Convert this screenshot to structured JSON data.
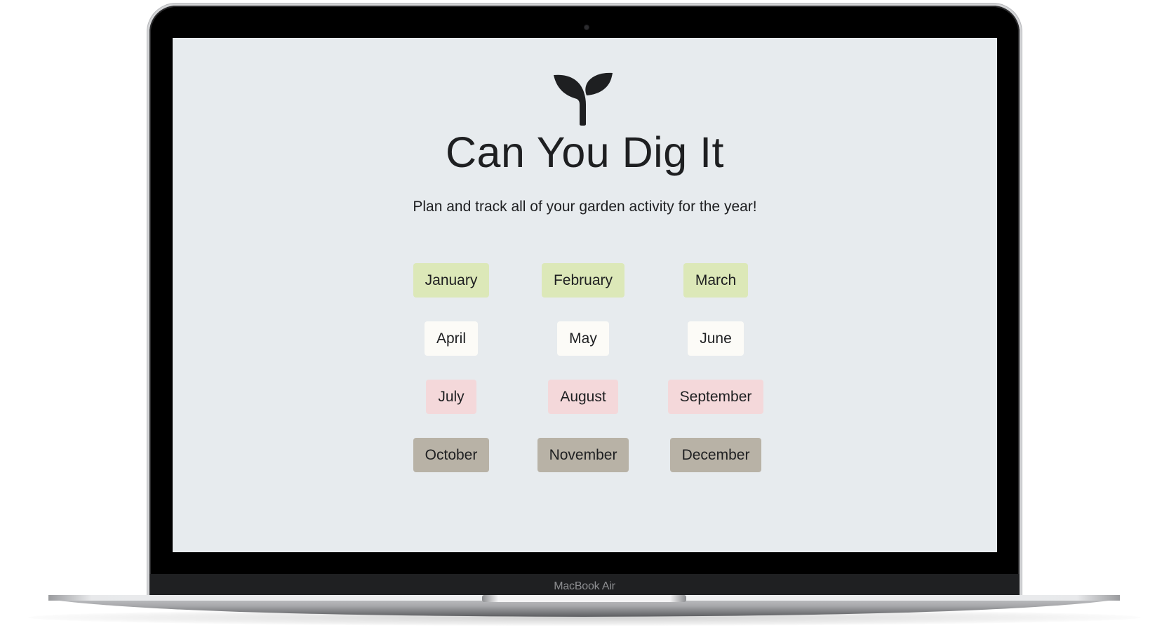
{
  "app": {
    "title": "Can You Dig It",
    "subtitle": "Plan and track all of your garden activity for the year!",
    "logo_icon": "sprout-icon"
  },
  "device": {
    "label": "MacBook Air"
  },
  "colors": {
    "screen_background": "#e7ebee",
    "text": "#1e1f21",
    "winter": "#dce8b8",
    "spring": "#fcfbf7",
    "summer": "#f4d8da",
    "autumn": "#b8b2a6"
  },
  "months": [
    {
      "label": "January",
      "season": "winter",
      "color": "#dce8b8"
    },
    {
      "label": "February",
      "season": "winter",
      "color": "#dce8b8"
    },
    {
      "label": "March",
      "season": "winter",
      "color": "#dce8b8"
    },
    {
      "label": "April",
      "season": "spring",
      "color": "#fcfbf7"
    },
    {
      "label": "May",
      "season": "spring",
      "color": "#fcfbf7"
    },
    {
      "label": "June",
      "season": "spring",
      "color": "#fcfbf7"
    },
    {
      "label": "July",
      "season": "summer",
      "color": "#f4d8da"
    },
    {
      "label": "August",
      "season": "summer",
      "color": "#f4d8da"
    },
    {
      "label": "September",
      "season": "summer",
      "color": "#f4d8da"
    },
    {
      "label": "October",
      "season": "autumn",
      "color": "#b8b2a6"
    },
    {
      "label": "November",
      "season": "autumn",
      "color": "#b8b2a6"
    },
    {
      "label": "December",
      "season": "autumn",
      "color": "#b8b2a6"
    }
  ]
}
